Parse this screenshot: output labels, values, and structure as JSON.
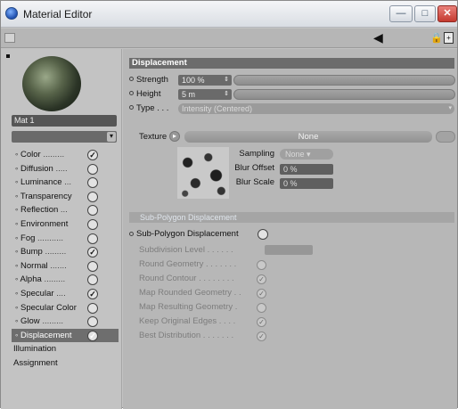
{
  "window": {
    "title": "Material Editor",
    "icon": "material-editor-icon"
  },
  "material": {
    "name": "Mat 1"
  },
  "channels": [
    {
      "label": "Color",
      "checked": true
    },
    {
      "label": "Diffusion",
      "checked": false
    },
    {
      "label": "Luminance",
      "checked": false
    },
    {
      "label": "Transparency",
      "checked": false
    },
    {
      "label": "Reflection",
      "checked": false
    },
    {
      "label": "Environment",
      "checked": false
    },
    {
      "label": "Fog",
      "checked": false
    },
    {
      "label": "Bump",
      "checked": true
    },
    {
      "label": "Normal",
      "checked": false
    },
    {
      "label": "Alpha",
      "checked": false
    },
    {
      "label": "Specular",
      "checked": true
    },
    {
      "label": "Specular Color",
      "checked": false
    },
    {
      "label": "Glow",
      "checked": false
    },
    {
      "label": "Displacement",
      "checked": true,
      "active": true
    }
  ],
  "extra_items": [
    "Illumination",
    "Assignment"
  ],
  "displacement": {
    "header": "Displacement",
    "strength_label": "Strength",
    "strength_value": "100 %",
    "height_label": "Height",
    "height_value": "5 m",
    "type_label": "Type",
    "type_value": "Intensity (Centered)",
    "texture_label": "Texture",
    "texture_value": "None",
    "sampling_label": "Sampling",
    "sampling_value": "None",
    "blur_offset_label": "Blur Offset",
    "blur_offset_value": "0 %",
    "blur_scale_label": "Blur Scale",
    "blur_scale_value": "0 %"
  },
  "subpolygon": {
    "header": "Sub-Polygon Displacement",
    "toggle_label": "Sub-Polygon Displacement",
    "options": [
      {
        "label": "Subdivision Level",
        "type": "field"
      },
      {
        "label": "Round Geometry",
        "type": "check",
        "checked": false
      },
      {
        "label": "Round Contour",
        "type": "check",
        "checked": true
      },
      {
        "label": "Map Rounded Geometry",
        "type": "check",
        "checked": true
      },
      {
        "label": "Map Resulting Geometry",
        "type": "check",
        "checked": false
      },
      {
        "label": "Keep Original Edges",
        "type": "check",
        "checked": true
      },
      {
        "label": "Best Distribution",
        "type": "check",
        "checked": true
      }
    ]
  }
}
